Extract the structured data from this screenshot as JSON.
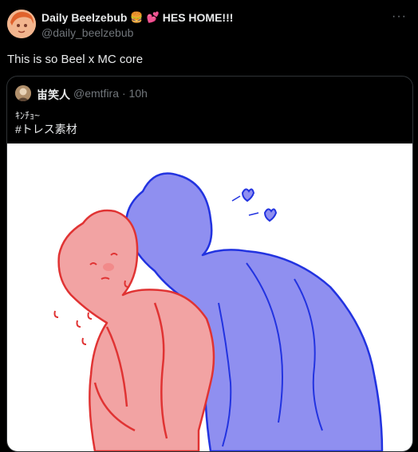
{
  "author": {
    "name": "Daily Beelzebub",
    "name_suffix": "HES HOME!!!",
    "handle": "@daily_beelzebub"
  },
  "more_icon": "more-horizontal-icon",
  "tweet": {
    "text": "This is so Beel x MC core"
  },
  "quote": {
    "name": "峀笑人",
    "handle": "@emtfira",
    "time": "· 10h",
    "line1": "ｷﾝﾁｮ~",
    "line2": "#トレス素材"
  },
  "colors": {
    "accent": "#1d9bf0",
    "text_primary": "#e7e9ea",
    "text_secondary": "#71767b",
    "border": "#2f3336",
    "figure_red": "#f2a3a3",
    "figure_blue": "#8f8ff0"
  }
}
